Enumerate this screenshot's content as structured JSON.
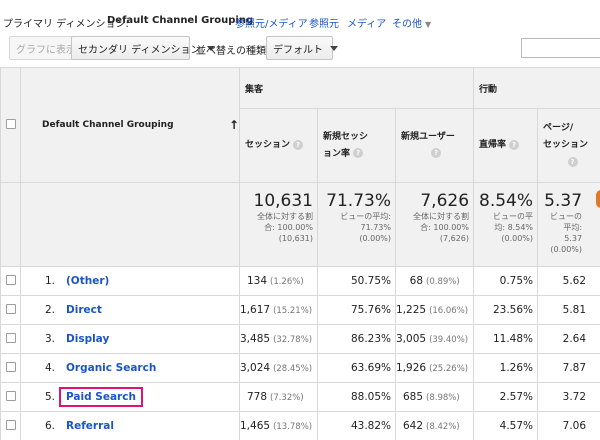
{
  "header": {
    "primary_dimension_label": "プライマリ ディメンション:",
    "primary_dimension_value": "Default Channel Grouping",
    "links": [
      "参照元/メディア",
      "参照元",
      "メディア",
      "その他"
    ]
  },
  "toolbar": {
    "graph_button": "グラフに表示",
    "secondary_dimension": "セカンダリ ディメンション",
    "sort_label": "並べ替えの種類:",
    "sort_value": "デフォルト"
  },
  "table": {
    "group_acquisition": "集客",
    "group_behavior": "行動",
    "dimension_header": "Default Channel Grouping",
    "columns": [
      {
        "line1": "セッション",
        "line2": ""
      },
      {
        "line1": "新規セッシ",
        "line2": "ョン率"
      },
      {
        "line1": "新規ユーザー",
        "line2": ""
      },
      {
        "line1": "直帰率",
        "line2": ""
      },
      {
        "line1": "ページ/",
        "line2": "セッション"
      }
    ],
    "summary": [
      {
        "value": "10,631",
        "l1": "全体に対する割",
        "l2": "合: 100.00%",
        "l3": "(10,631)"
      },
      {
        "value": "71.73%",
        "l1": "ビューの平均:",
        "l2": "71.73%",
        "l3": "(0.00%)"
      },
      {
        "value": "7,626",
        "l1": "全体に対する割",
        "l2": "合: 100.00%",
        "l3": "(7,626)"
      },
      {
        "value": "8.54%",
        "l1": "ビューの平",
        "l2": "均: 8.54%",
        "l3": "(0.00%)"
      },
      {
        "value": "5.37",
        "l1": "ビューの",
        "l2": "平均:",
        "l3": "5.37"
      }
    ],
    "summary_extra": "(0.00%)",
    "rows": [
      {
        "num": "1.",
        "name": "(Other)",
        "sessions": "134",
        "sessions_pct": "(1.26%)",
        "new_rate": "50.75%",
        "new_users": "68",
        "users_pct": "(0.89%)",
        "bounce": "0.75%",
        "pages": "5.62"
      },
      {
        "num": "2.",
        "name": "Direct",
        "sessions": "1,617",
        "sessions_pct": "(15.21%)",
        "new_rate": "75.76%",
        "new_users": "1,225",
        "users_pct": "(16.06%)",
        "bounce": "23.56%",
        "pages": "5.81"
      },
      {
        "num": "3.",
        "name": "Display",
        "sessions": "3,485",
        "sessions_pct": "(32.78%)",
        "new_rate": "86.23%",
        "new_users": "3,005",
        "users_pct": "(39.40%)",
        "bounce": "11.48%",
        "pages": "2.64"
      },
      {
        "num": "4.",
        "name": "Organic Search",
        "sessions": "3,024",
        "sessions_pct": "(28.45%)",
        "new_rate": "63.69%",
        "new_users": "1,926",
        "users_pct": "(25.26%)",
        "bounce": "1.26%",
        "pages": "7.87"
      },
      {
        "num": "5.",
        "name": "Paid Search",
        "sessions": "778",
        "sessions_pct": "(7.32%)",
        "new_rate": "88.05%",
        "new_users": "685",
        "users_pct": "(8.98%)",
        "bounce": "2.57%",
        "pages": "3.72"
      },
      {
        "num": "6.",
        "name": "Referral",
        "sessions": "1,465",
        "sessions_pct": "(13.78%)",
        "new_rate": "43.82%",
        "new_users": "642",
        "users_pct": "(8.42%)",
        "bounce": "4.57%",
        "pages": "7.06"
      }
    ]
  },
  "colors": {
    "link": "#1a55c8",
    "highlight": "#e2136e",
    "accent_orange": "#e07a27"
  }
}
